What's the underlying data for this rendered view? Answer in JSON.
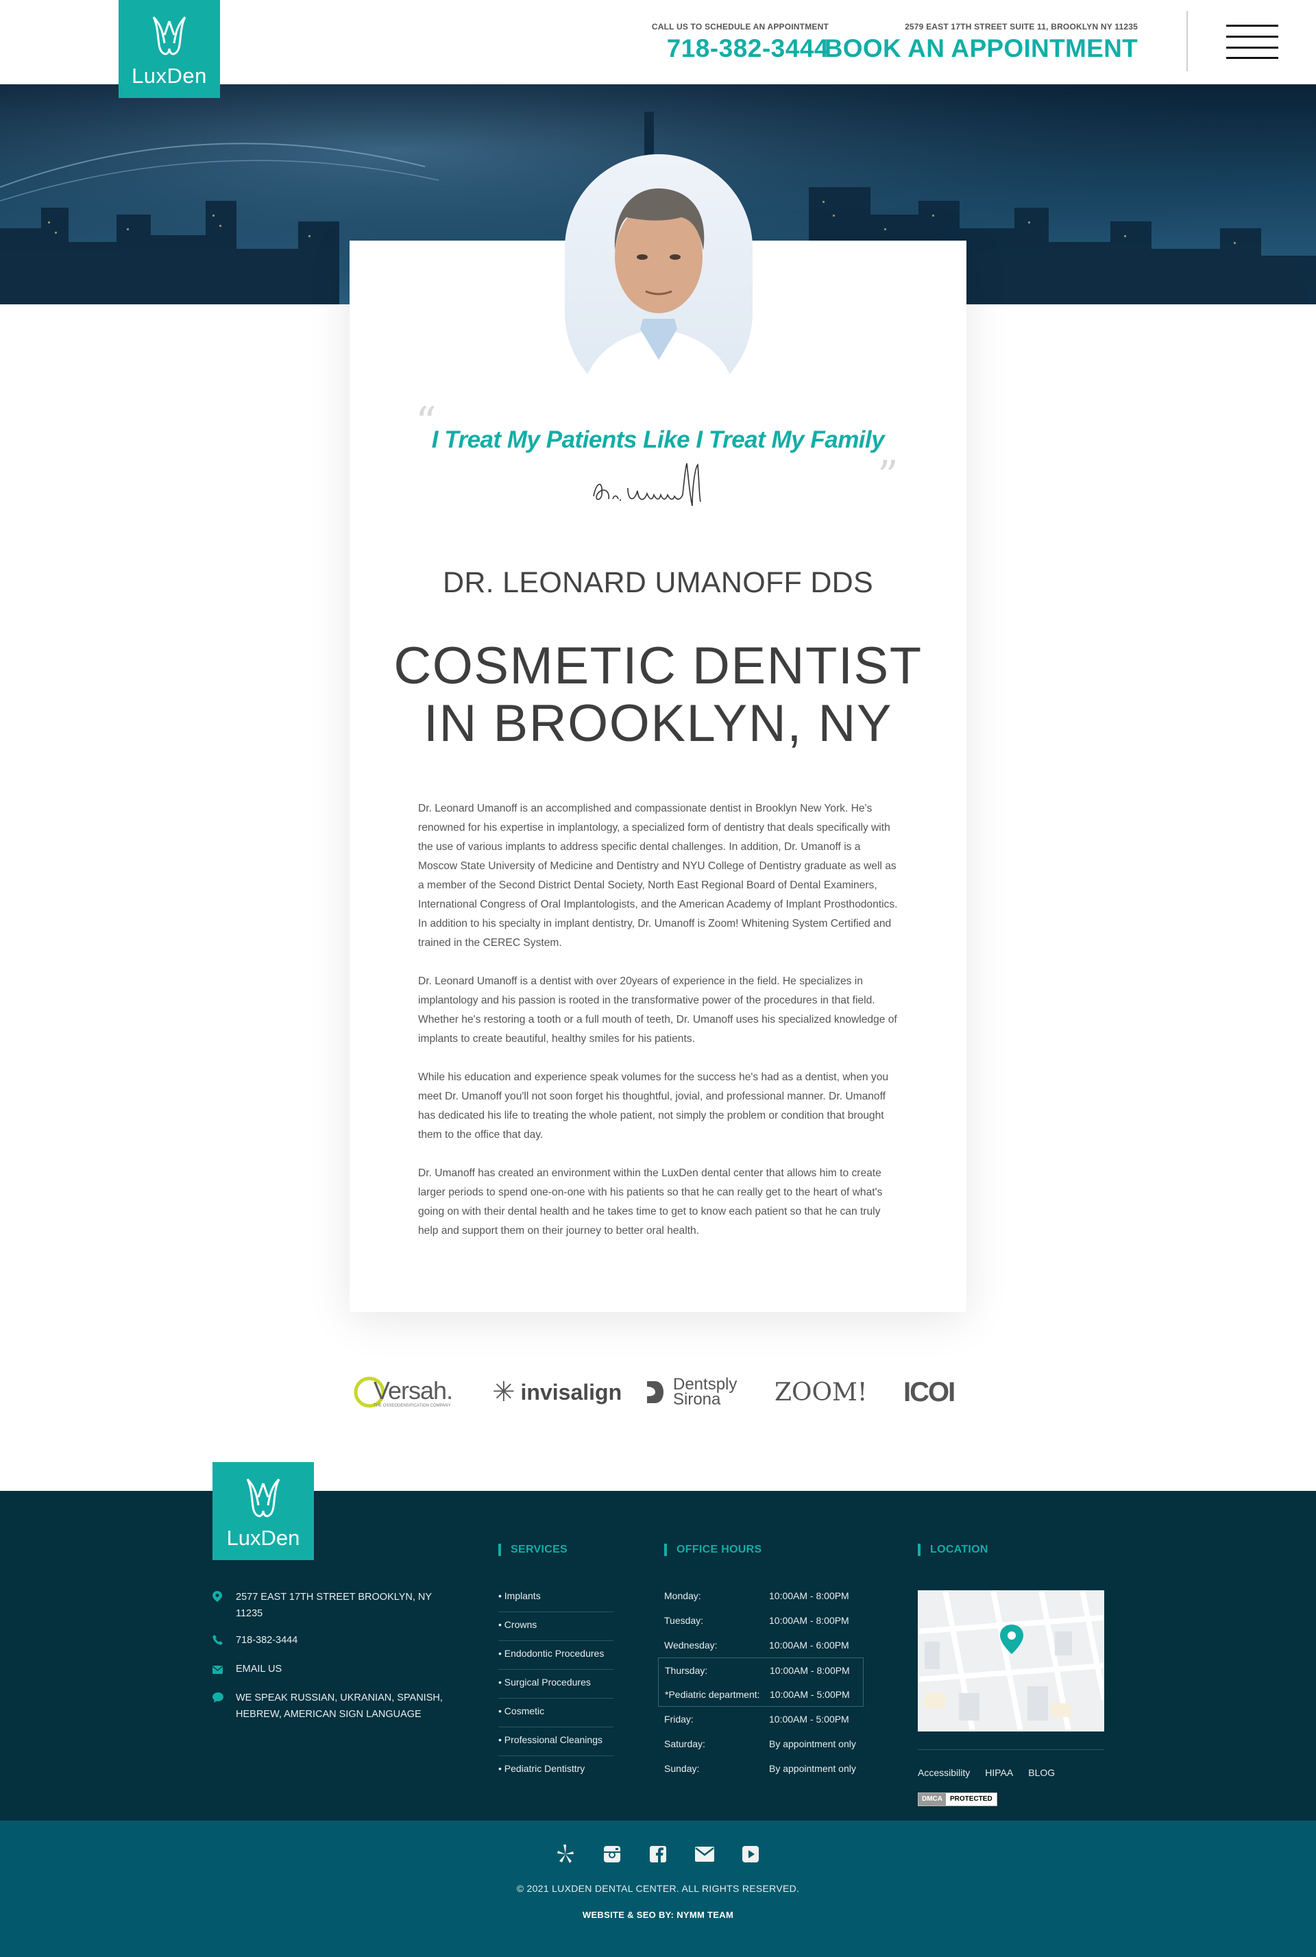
{
  "brand": {
    "name": "LuxDen",
    "accent": "#12aea6",
    "footer_bg": "#05303d",
    "subfooter_bg": "#03596b"
  },
  "header": {
    "call_label": "CALL US TO SCHEDULE AN APPOINTMENT",
    "phone": "718-382-3444",
    "address": "2579 EAST 17TH STREET SUITE 11, BROOKLYN NY 11235",
    "cta": "BOOK AN APPOINTMENT",
    "menu_icon": "hamburger-menu-icon"
  },
  "profile": {
    "tagline": "I Treat My Patients Like I Treat My Family",
    "signature": "Dr. Umanoff",
    "doctor_name": "DR. LEONARD UMANOFF DDS",
    "title_line1": "COSMETIC DENTIST",
    "title_line2": "IN BROOKLYN, NY",
    "bio": [
      "Dr. Leonard Umanoff is an accomplished and compassionate dentist in Brooklyn New York. He's renowned for his expertise in implantology, a specialized form of dentistry that deals specifically with the use of various implants to address specific dental challenges. In addition, Dr. Umanoff is a Moscow State University of Medicine and Dentistry and NYU College of Dentistry graduate as well as a member of the Second District Dental Society, North East Regional Board of Dental Examiners, International Congress of Oral Implantologists, and the American Academy of Implant Prosthodontics. In addition to his specialty in implant dentistry, Dr. Umanoff is Zoom! Whitening System Certified and trained in the CEREC System.",
      "Dr. Leonard Umanoff is a dentist with over 20years of experience in the field. He specializes in implantology and his passion is rooted in the transformative power of the procedures in that field. Whether he's restoring a tooth or a full mouth of teeth, Dr. Umanoff uses his specialized knowledge of implants to create beautiful, healthy smiles for his patients.",
      "While his education and experience speak volumes for the success he's had as a dentist, when you meet Dr. Umanoff you'll not soon forget his thoughtful, jovial, and professional manner. Dr. Umanoff has dedicated his life to treating the whole patient, not simply the problem or condition that brought them to the office that day.",
      "Dr. Umanoff has created an environment within the LuxDen dental center that allows him to create larger periods to spend one-on-one with his patients so that he can really get to the heart of what's going on with their dental health and he takes time to get to know each patient so that he can truly help and support them on their journey to better oral health."
    ]
  },
  "partners": {
    "versah": "Versah.",
    "versah_sub": "THE OSSEODENSIFICATION COMPANY",
    "invisalign": "invisalign",
    "dentsply_1": "Dentsply",
    "dentsply_2": "Sirona",
    "zoom": "ZOOM!",
    "icoi": "ICOI"
  },
  "footer": {
    "contact": {
      "address": "2577 EAST 17TH STREET BROOKLYN, NY 11235",
      "phone": "718-382-3444",
      "email": "EMAIL US",
      "languages": "WE SPEAK RUSSIAN, UKRANIAN, SPANISH, HEBREW, AMERICAN SIGN LANGUAGE"
    },
    "services_title": "SERVICES",
    "services": [
      "• Implants",
      "• Crowns",
      "• Endodontic Procedures",
      "• Surgical Procedures",
      "• Cosmetic",
      "• Professional Cleanings",
      "• Pediatric Dentisttry"
    ],
    "hours_title": "OFFICE HOURS",
    "hours": [
      {
        "day": "Monday:",
        "time": "10:00AM - 8:00PM"
      },
      {
        "day": "Tuesday:",
        "time": "10:00AM - 8:00PM"
      },
      {
        "day": "Wednesday:",
        "time": "10:00AM - 6:00PM"
      },
      {
        "day": "Thursday:",
        "time": "10:00AM - 8:00PM"
      },
      {
        "day": "*Pediatric department:",
        "time": "10:00AM - 5:00PM"
      },
      {
        "day": "Friday:",
        "time": "10:00AM - 5:00PM"
      },
      {
        "day": "Saturday:",
        "time": "By appointment only"
      },
      {
        "day": "Sunday:",
        "time": "By appointment only"
      }
    ],
    "location_title": "LOCATION",
    "links": {
      "accessibility": "Accessibility",
      "hipaa": "HIPAA",
      "blog": "BLOG"
    },
    "dmca_a": "DMCA",
    "dmca_b": "PROTECTED",
    "social_icons": [
      "yelp-icon",
      "instagram-icon",
      "facebook-icon",
      "email-icon",
      "youtube-icon"
    ],
    "copyright": "© 2021 LUXDEN DENTAL CENTER. ALL RIGHTS RESERVED.",
    "credits": "WEBSITE & SEO BY: NYMM TEAM"
  }
}
